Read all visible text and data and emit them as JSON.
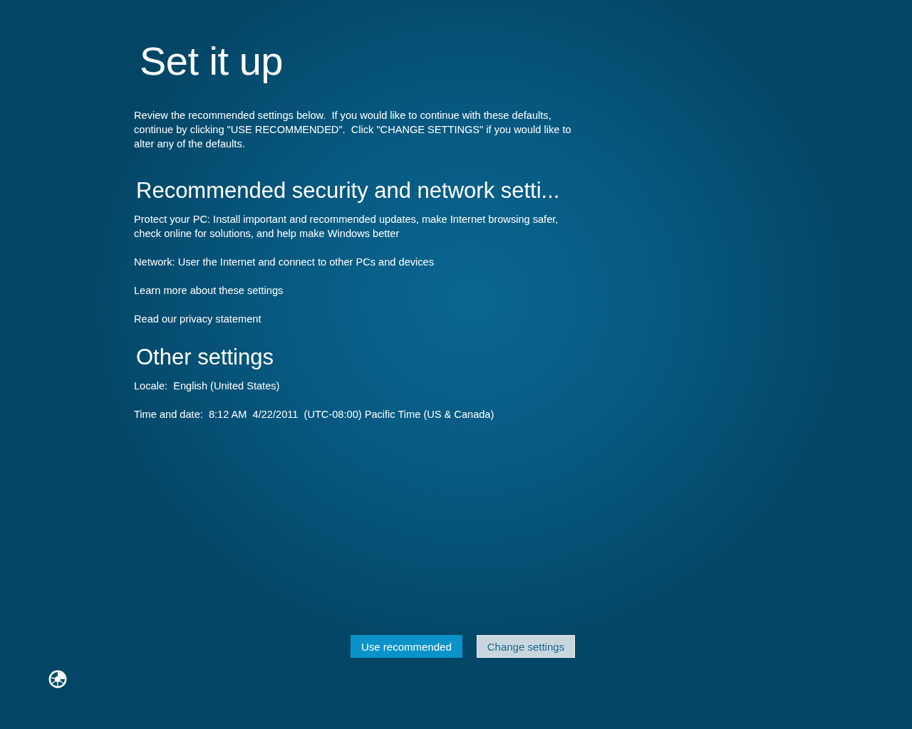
{
  "title": "Set it up",
  "intro": "Review the recommended settings below.  If you would like to continue with these defaults, continue by clicking \"USE RECOMMENDED\".  Click \"CHANGE SETTINGS\" if you would like to alter any of the defaults.",
  "sections": [
    {
      "heading": "Recommended security and network setti...",
      "items": [
        {
          "kind": "text",
          "text": "Protect your PC: Install important and recommended updates, make Internet browsing safer, check online for solutions, and help make Windows better"
        },
        {
          "kind": "text",
          "text": "Network: User the Internet and connect to other PCs and devices"
        },
        {
          "kind": "link",
          "text": "Learn more about these settings"
        },
        {
          "kind": "link",
          "text": "Read our privacy statement"
        }
      ]
    },
    {
      "heading": "Other settings",
      "items": [
        {
          "kind": "text",
          "text": "Locale:  English (United States)"
        },
        {
          "kind": "text",
          "text": "Time and date:  8:12 AM  4/22/2011  (UTC-08:00) Pacific Time (US & Canada)"
        }
      ]
    }
  ],
  "buttons": [
    {
      "label": "Use recommended",
      "kind": "primary"
    },
    {
      "label": "Change settings",
      "kind": "secondary"
    }
  ]
}
